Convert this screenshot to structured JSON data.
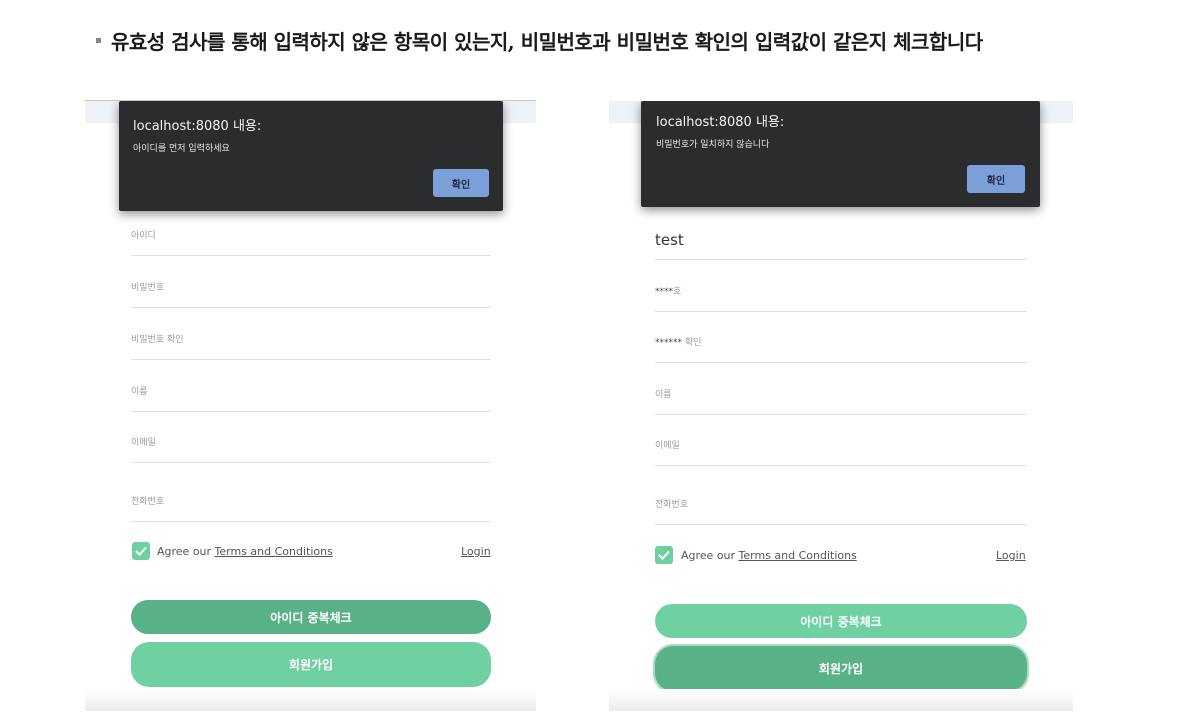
{
  "heading": "유효성 검사를 통해 입력하지 않은 항목이 있는지, 비밀번호과 비밀번호 확인의 입력값이 같은지 체크합니다",
  "colors": {
    "dialog_bg": "#2a2c2e",
    "dialog_button": "#7b9fd8",
    "green_dark": "#58b187",
    "green_light": "#6fd0a2"
  },
  "left": {
    "dialog": {
      "title": "localhost:8080 내용:",
      "message": "아이디를 먼저 입력하세요",
      "ok_label": "확인"
    },
    "fields": {
      "id_placeholder": "아이디",
      "pw_placeholder": "비밀번호",
      "pw_confirm_placeholder": "비밀번호 확인",
      "name_placeholder": "이름",
      "email_placeholder": "이메일",
      "phone_placeholder": "전화번호"
    },
    "agree_prefix": "Agree our ",
    "terms_link": "Terms and Conditions",
    "login_link": "Login",
    "agree_checked": true,
    "dup_check_button": "아이디 중복체크",
    "signup_button": "회원가입"
  },
  "right": {
    "dialog": {
      "title": "localhost:8080 내용:",
      "message": "비밀번호가 일치하지 않습니다",
      "ok_label": "확인"
    },
    "fields": {
      "id_value": "test",
      "pw_mask": "****",
      "pw_ph_suffix": "호",
      "pw_confirm_mask": "******",
      "pw_confirm_ph_suffix": " 확인",
      "name_placeholder": "이름",
      "email_placeholder": "이메일",
      "phone_placeholder": "전화번호"
    },
    "agree_prefix": "Agree our ",
    "terms_link": "Terms and Conditions",
    "login_link": "Login",
    "agree_checked": true,
    "dup_check_button": "아이디 중복체크",
    "signup_button": "회원가입"
  }
}
